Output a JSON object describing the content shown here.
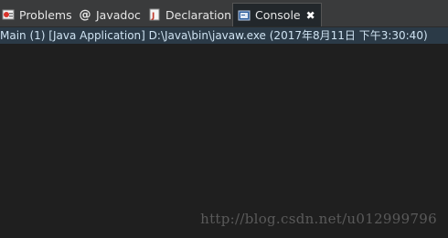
{
  "tabs": [
    {
      "label": "Problems",
      "icon": "problems-icon"
    },
    {
      "label": "Javadoc",
      "icon": "at-icon",
      "glyph": "@"
    },
    {
      "label": "Declaration",
      "icon": "declaration-icon"
    },
    {
      "label": "Console",
      "icon": "console-icon",
      "active": true,
      "close": "✖"
    }
  ],
  "console": {
    "launch_info": "Main (1) [Java Application] D:\\Java\\bin\\javaw.exe (2017年8月11日 下午3:30:40)"
  },
  "watermark": "http://blog.csdn.net/u012999796",
  "colors": {
    "tabbar_bg": "#3a3b3c",
    "active_tab_bg": "#22272b",
    "info_bar_bg": "#2b3a47",
    "console_bg": "#1f1f1f"
  }
}
